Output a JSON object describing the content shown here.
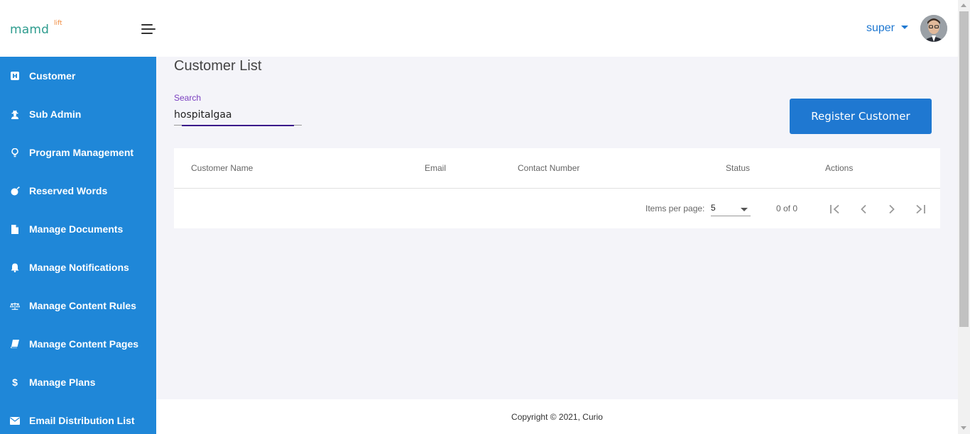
{
  "brand": {
    "logo_main": "mamd",
    "logo_sup": "lift",
    "primary_color": "#1f87d8",
    "accent_color": "#1f78d1"
  },
  "header": {
    "user_name": "super"
  },
  "sidebar": {
    "items": [
      {
        "label": "Customer",
        "icon": "hospital-icon"
      },
      {
        "label": "Sub Admin",
        "icon": "user-secret-icon"
      },
      {
        "label": "Program Management",
        "icon": "lightbulb-icon"
      },
      {
        "label": "Reserved Words",
        "icon": "bomb-icon"
      },
      {
        "label": "Manage Documents",
        "icon": "file-icon"
      },
      {
        "label": "Manage Notifications",
        "icon": "bell-icon"
      },
      {
        "label": "Manage Content Rules",
        "icon": "balance-scale-icon"
      },
      {
        "label": "Manage Content Pages",
        "icon": "book-icon"
      },
      {
        "label": "Manage Plans",
        "icon": "dollar-icon"
      },
      {
        "label": "Email Distribution List",
        "icon": "envelope-icon"
      }
    ]
  },
  "main": {
    "title": "Customer List",
    "search": {
      "label": "Search",
      "value": "hospitalgaa"
    },
    "register_button": "Register Customer",
    "table": {
      "columns": [
        "Customer Name",
        "Email",
        "Contact Number",
        "Status",
        "Actions"
      ],
      "rows": []
    },
    "paginator": {
      "items_per_page_label": "Items per page:",
      "items_per_page": "5",
      "range": "0 of 0"
    }
  },
  "footer": {
    "text": "Copyright © 2021, Curio"
  }
}
